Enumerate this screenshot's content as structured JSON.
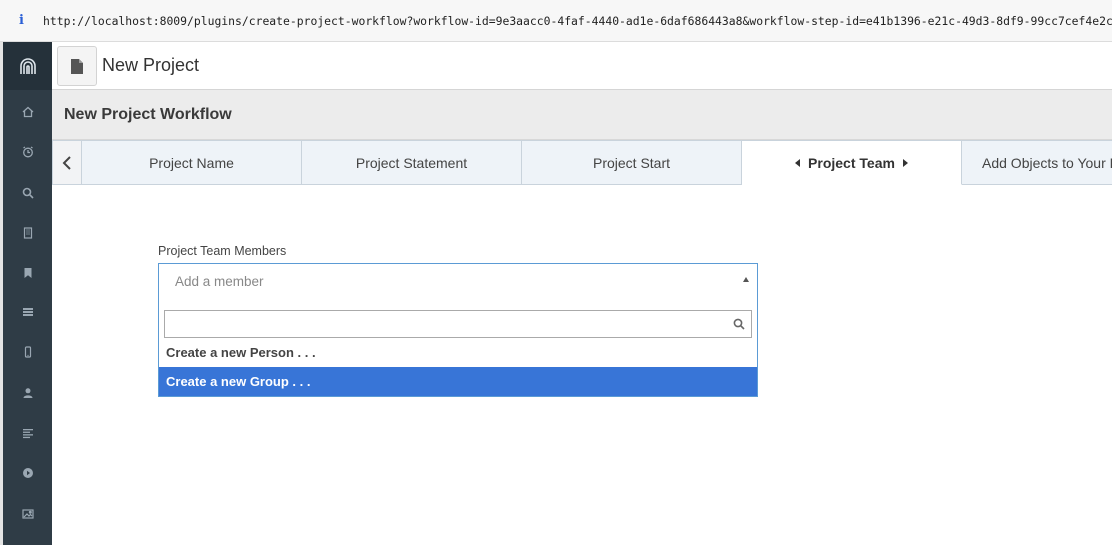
{
  "browser": {
    "info_glyph": "i",
    "url": "http://localhost:8009/plugins/create-project-workflow?workflow-id=9e3aacc0-4faf-4440-ad1e-6daf686443a8&workflow-step-id=e41b1396-e21c-49d3-8df9-99cc7cef4e2c"
  },
  "sidebar": {
    "logo_icon": "arches-logo-icon",
    "items": [
      {
        "icon": "home-icon"
      },
      {
        "icon": "alarm-clock-icon"
      },
      {
        "icon": "search-icon"
      },
      {
        "icon": "building-icon"
      },
      {
        "icon": "bookmark-icon"
      },
      {
        "icon": "table-icon"
      },
      {
        "icon": "mobile-icon"
      },
      {
        "icon": "user-icon"
      },
      {
        "icon": "align-left-icon"
      },
      {
        "icon": "play-circle-icon"
      },
      {
        "icon": "image-icon"
      }
    ]
  },
  "header": {
    "title": "New Project"
  },
  "workflow": {
    "title": "New Project Workflow",
    "tabs": [
      {
        "label": "Project Name"
      },
      {
        "label": "Project Statement"
      },
      {
        "label": "Project Start"
      },
      {
        "label": "Project Team",
        "active": true
      },
      {
        "label": "Add Objects to Your Project"
      }
    ]
  },
  "form": {
    "label": "Project Team Members",
    "placeholder": "Add a member",
    "search_value": "",
    "options": [
      {
        "label": "Create a new Person . . ."
      },
      {
        "label": "Create a new Group . . .",
        "highlighted": true
      }
    ]
  },
  "colors": {
    "sidebar": "#2f3c46",
    "highlight": "#3875d7",
    "tab_border": "#c9d3dc"
  }
}
